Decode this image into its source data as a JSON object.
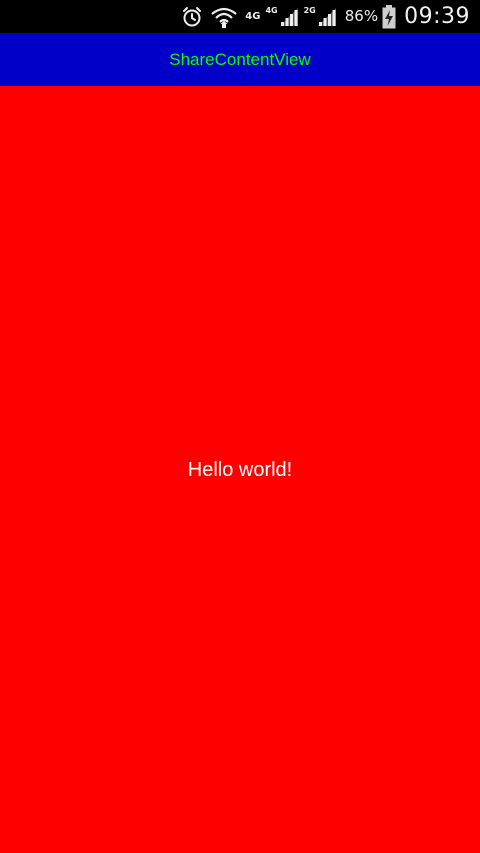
{
  "status_bar": {
    "network_4g_label": "4G",
    "network_4g_small_label": "4G",
    "network_2g_small_label": "2G",
    "battery_percent": "86%",
    "time": "09:39",
    "icons": [
      "alarm-icon",
      "wifi-icon",
      "signal-icon",
      "signal-icon",
      "battery-charging-icon"
    ]
  },
  "action_bar": {
    "title": "ShareContentView",
    "background_color": "#0000c8",
    "title_color": "#00ff00"
  },
  "content": {
    "message": "Hello world!",
    "background_color": "#ff0000",
    "text_color": "#ffffff"
  }
}
